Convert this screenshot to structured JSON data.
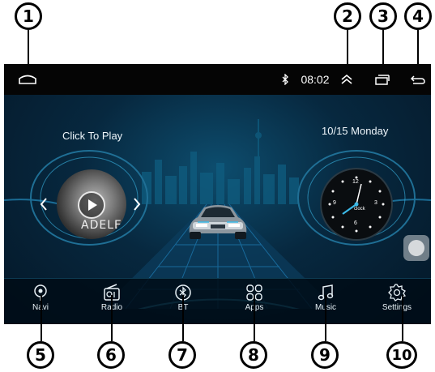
{
  "callouts": [
    "1",
    "2",
    "3",
    "4",
    "5",
    "6",
    "7",
    "8",
    "9",
    "10"
  ],
  "status_bar": {
    "time": "08:02",
    "bluetooth_icon": "bluetooth-icon",
    "home_icon": "home-icon",
    "expand_icon": "chevron-up-icon",
    "recents_icon": "recent-apps-icon",
    "back_icon": "back-arrow-icon"
  },
  "media": {
    "click_to_play": "Click To Play",
    "album_text": "ADELE"
  },
  "clock": {
    "date": "10/15 Monday",
    "label": "clock",
    "numerals": [
      "12",
      "3",
      "6",
      "9"
    ]
  },
  "dock": [
    {
      "label": "Navi",
      "icon": "location-pin-icon"
    },
    {
      "label": "Radio",
      "icon": "radio-icon"
    },
    {
      "label": "BT",
      "icon": "bluetooth-icon"
    },
    {
      "label": "Apps",
      "icon": "apps-grid-icon"
    },
    {
      "label": "Music",
      "icon": "music-note-icon"
    },
    {
      "label": "Settings",
      "icon": "gear-icon"
    }
  ],
  "colors": {
    "accent": "#3bb8e6",
    "status_bar": "#050505",
    "background": "#07283f"
  }
}
